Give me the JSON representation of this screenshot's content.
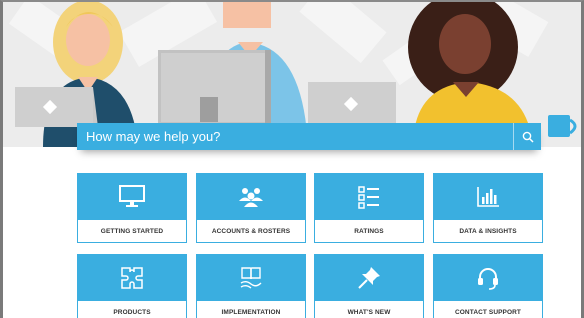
{
  "search": {
    "placeholder": "How may we help you?"
  },
  "categories": [
    {
      "label": "GETTING STARTED",
      "icon": "monitor-icon"
    },
    {
      "label": "ACCOUNTS & ROSTERS",
      "icon": "people-group-icon"
    },
    {
      "label": "RATINGS",
      "icon": "checklist-icon"
    },
    {
      "label": "DATA & INSIGHTS",
      "icon": "bar-chart-icon"
    },
    {
      "label": "PRODUCTS",
      "icon": "puzzle-icon"
    },
    {
      "label": "IMPLEMENTATION",
      "icon": "book-hands-icon"
    },
    {
      "label": "WHAT'S NEW",
      "icon": "pushpin-icon"
    },
    {
      "label": "CONTACT SUPPORT",
      "icon": "headset-icon"
    }
  ],
  "colors": {
    "accent": "#3aaee0",
    "hero_bg": "#ededed",
    "mustard_shirt": "#f2c12e",
    "teal_shirt": "#1f4e6b"
  }
}
